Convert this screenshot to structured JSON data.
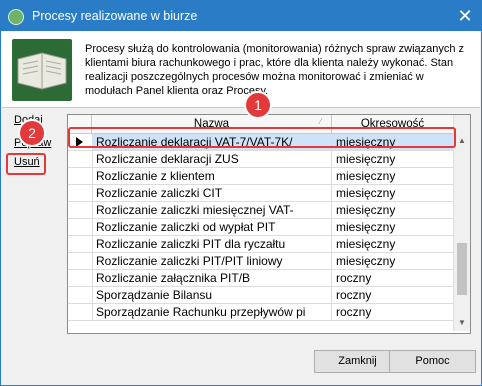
{
  "window": {
    "title": "Procesy realizowane w biurze",
    "description": "Procesy służą do kontrolowania (monitorowania) różnych spraw związanych z klientami biura rachunkowego i prac, które dla klienta należy wykonać. Stan realizacji poszczególnych procesów można monitorować i zmieniać w modułach Panel klienta oraz Procesy."
  },
  "sidebar": {
    "add_label": "Dodaj",
    "edit_label": "Popraw",
    "delete_label": "Usuń"
  },
  "annotations": {
    "badge1": "1",
    "badge2": "2"
  },
  "table": {
    "columns": [
      "Nazwa",
      "Okresowość"
    ],
    "rows": [
      {
        "name": "Rozliczanie deklaracji VAT-7/VAT-7K/",
        "period": "miesięczny",
        "selected": true
      },
      {
        "name": "Rozliczanie deklaracji ZUS",
        "period": "miesięczny"
      },
      {
        "name": "Rozliczanie z klientem",
        "period": "miesięczny"
      },
      {
        "name": "Rozliczanie zaliczki CIT",
        "period": "miesięczny"
      },
      {
        "name": "Rozliczanie zaliczki miesięcznej VAT-",
        "period": "miesięczny"
      },
      {
        "name": "Rozliczanie zaliczki od wypłat PIT",
        "period": "miesięczny"
      },
      {
        "name": "Rozliczanie zaliczki PIT dla ryczałtu",
        "period": "miesięczny"
      },
      {
        "name": "Rozliczanie zaliczki PIT/PIT liniowy",
        "period": "miesięczny"
      },
      {
        "name": "Rozliczanie załącznika PIT/B",
        "period": "roczny"
      },
      {
        "name": "Sporządzanie Bilansu",
        "period": "roczny"
      },
      {
        "name": "Sporządzanie Rachunku przepływów pi",
        "period": "roczny"
      }
    ]
  },
  "buttons": {
    "close_label": "Zamknij",
    "help_label": "Pomoc"
  },
  "colors": {
    "titlebar": "#2b7cc7",
    "selection": "#cfe3f8",
    "annotation": "#e23a3a"
  }
}
